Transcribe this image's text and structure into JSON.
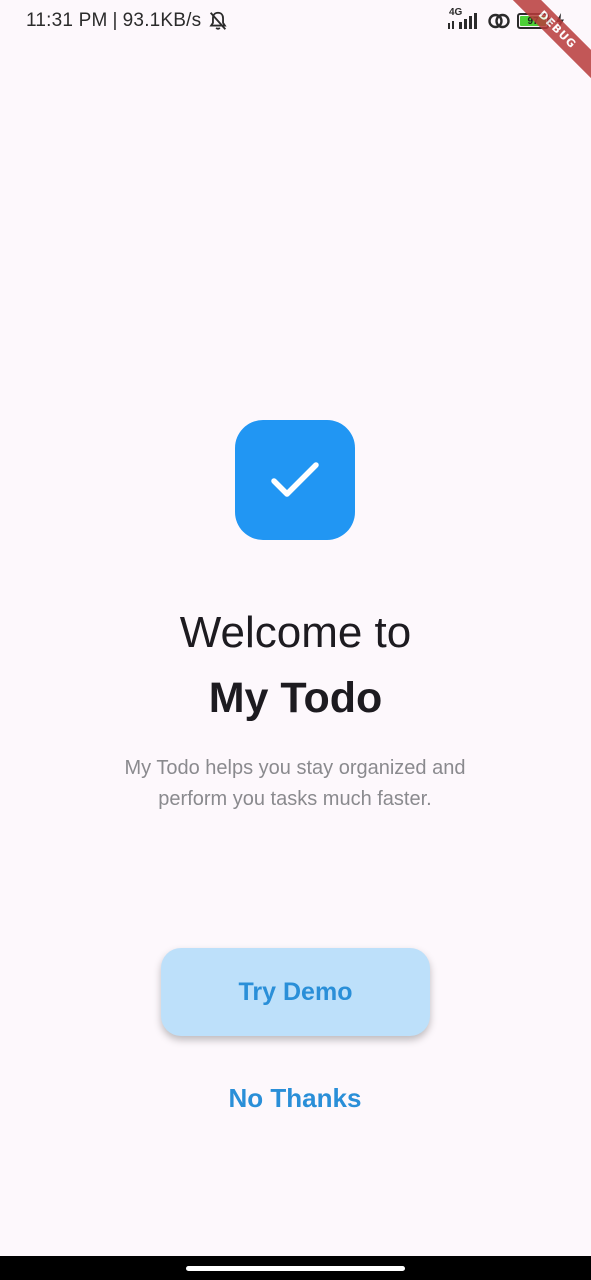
{
  "status_bar": {
    "time": "11:31 PM",
    "separator": "|",
    "network_speed": "93.1KB/s",
    "network_type": "4G",
    "battery_percent": "97",
    "icons": [
      "bell-muted-icon",
      "signal-icon",
      "link-icon",
      "battery-icon",
      "charging-icon"
    ]
  },
  "debug_banner": {
    "label": "DEBUG",
    "color": "#b83b3b"
  },
  "hero": {
    "logo_icon": "checkmark-icon",
    "logo_color": "#2196f3",
    "welcome_text": "Welcome to",
    "app_name": "My Todo",
    "description": "My Todo helps you stay organized and perform you tasks much faster."
  },
  "actions": {
    "try_demo_label": "Try Demo",
    "no_thanks_label": "No Thanks",
    "accent_color": "#2a8fd8",
    "primary_bg": "#bde0fa"
  }
}
